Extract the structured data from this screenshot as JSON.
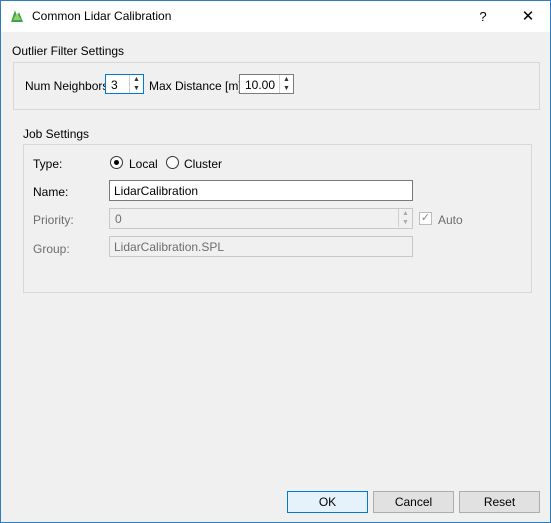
{
  "window": {
    "title": "Common Lidar Calibration",
    "help_label": "?",
    "close_label": "✕",
    "icon": "lidar-app-icon"
  },
  "outlier": {
    "title": "Outlier Filter Settings",
    "num_neighbors_label": "Num Neighbors",
    "num_neighbors_value": "3",
    "max_distance_label": "Max Distance [m]",
    "max_distance_value": "10.00"
  },
  "job": {
    "title": "Job Settings",
    "type_label": "Type:",
    "type_options": [
      "Local",
      "Cluster"
    ],
    "type_selected": "Local",
    "name_label": "Name:",
    "name_value": "LidarCalibration",
    "priority_label": "Priority:",
    "priority_value": "0",
    "auto_label": "Auto",
    "auto_checked": true,
    "group_label": "Group:",
    "group_value": "LidarCalibration.SPL"
  },
  "buttons": {
    "ok": "OK",
    "cancel": "Cancel",
    "reset": "Reset"
  },
  "colors": {
    "accent": "#0078d7",
    "window_border": "#2d7dc4",
    "background": "#f0f0f0"
  }
}
